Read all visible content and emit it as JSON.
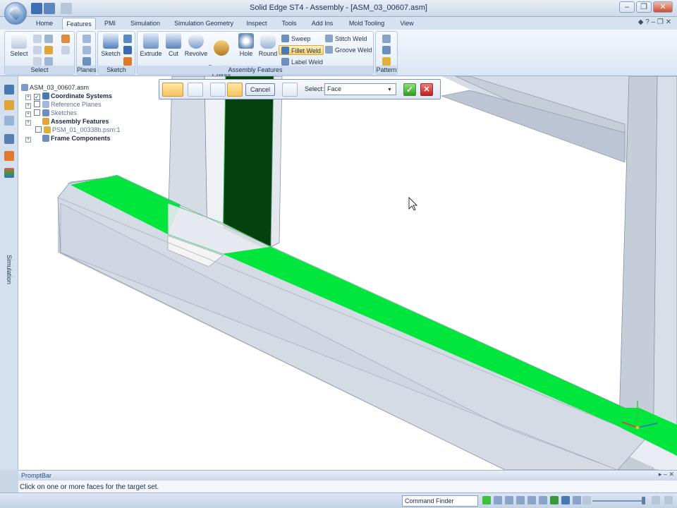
{
  "window": {
    "title": "Solid Edge ST4 - Assembly - [ASM_03_00607.asm]",
    "minimize": "–",
    "restore": "❐",
    "close": "✕"
  },
  "tabs": [
    "Home",
    "Features",
    "PMI",
    "Simulation",
    "Simulation Geometry",
    "Inspect",
    "Tools",
    "Add Ins",
    "Mold Tooling",
    "View"
  ],
  "active_tab": "Features",
  "ribbon": {
    "select": {
      "label": "Select",
      "group": "Select"
    },
    "planes": {
      "group": "Planes"
    },
    "sketch": {
      "label": "Sketch",
      "group": "Sketch"
    },
    "assembly_features": {
      "group": "Assembly Features",
      "extrude": "Extrude",
      "cut": "Cut",
      "revolve": "Revolve",
      "revolved_cutout": "Revolved\nCutout",
      "hole": "Hole",
      "round": "Round",
      "sweep": "Sweep",
      "fillet_weld": "Fillet Weld",
      "label_weld": "Label Weld",
      "stitch_weld": "Stitch Weld",
      "groove_weld": "Groove Weld"
    },
    "pattern": {
      "group": "Pattern"
    }
  },
  "tree": {
    "root": "ASM_03_00607.asm",
    "items": [
      "Coordinate Systems",
      "Reference Planes",
      "Sketches",
      "Assembly Features",
      "PSM_01_00338b.psm:1",
      "Frame Components"
    ]
  },
  "command_bar": {
    "cancel": "Cancel",
    "select_label": "Select:",
    "select_value": "Face"
  },
  "simulation_tab": "Simulation",
  "prompt": {
    "title": "PromptBar",
    "text": "Click on one or more faces for the target set."
  },
  "status": {
    "command_finder": "Command Finder"
  },
  "colors": {
    "highlight_green": "#00e63c",
    "dark_green": "#03420f",
    "ribbon_blue": "#dae5f3"
  }
}
